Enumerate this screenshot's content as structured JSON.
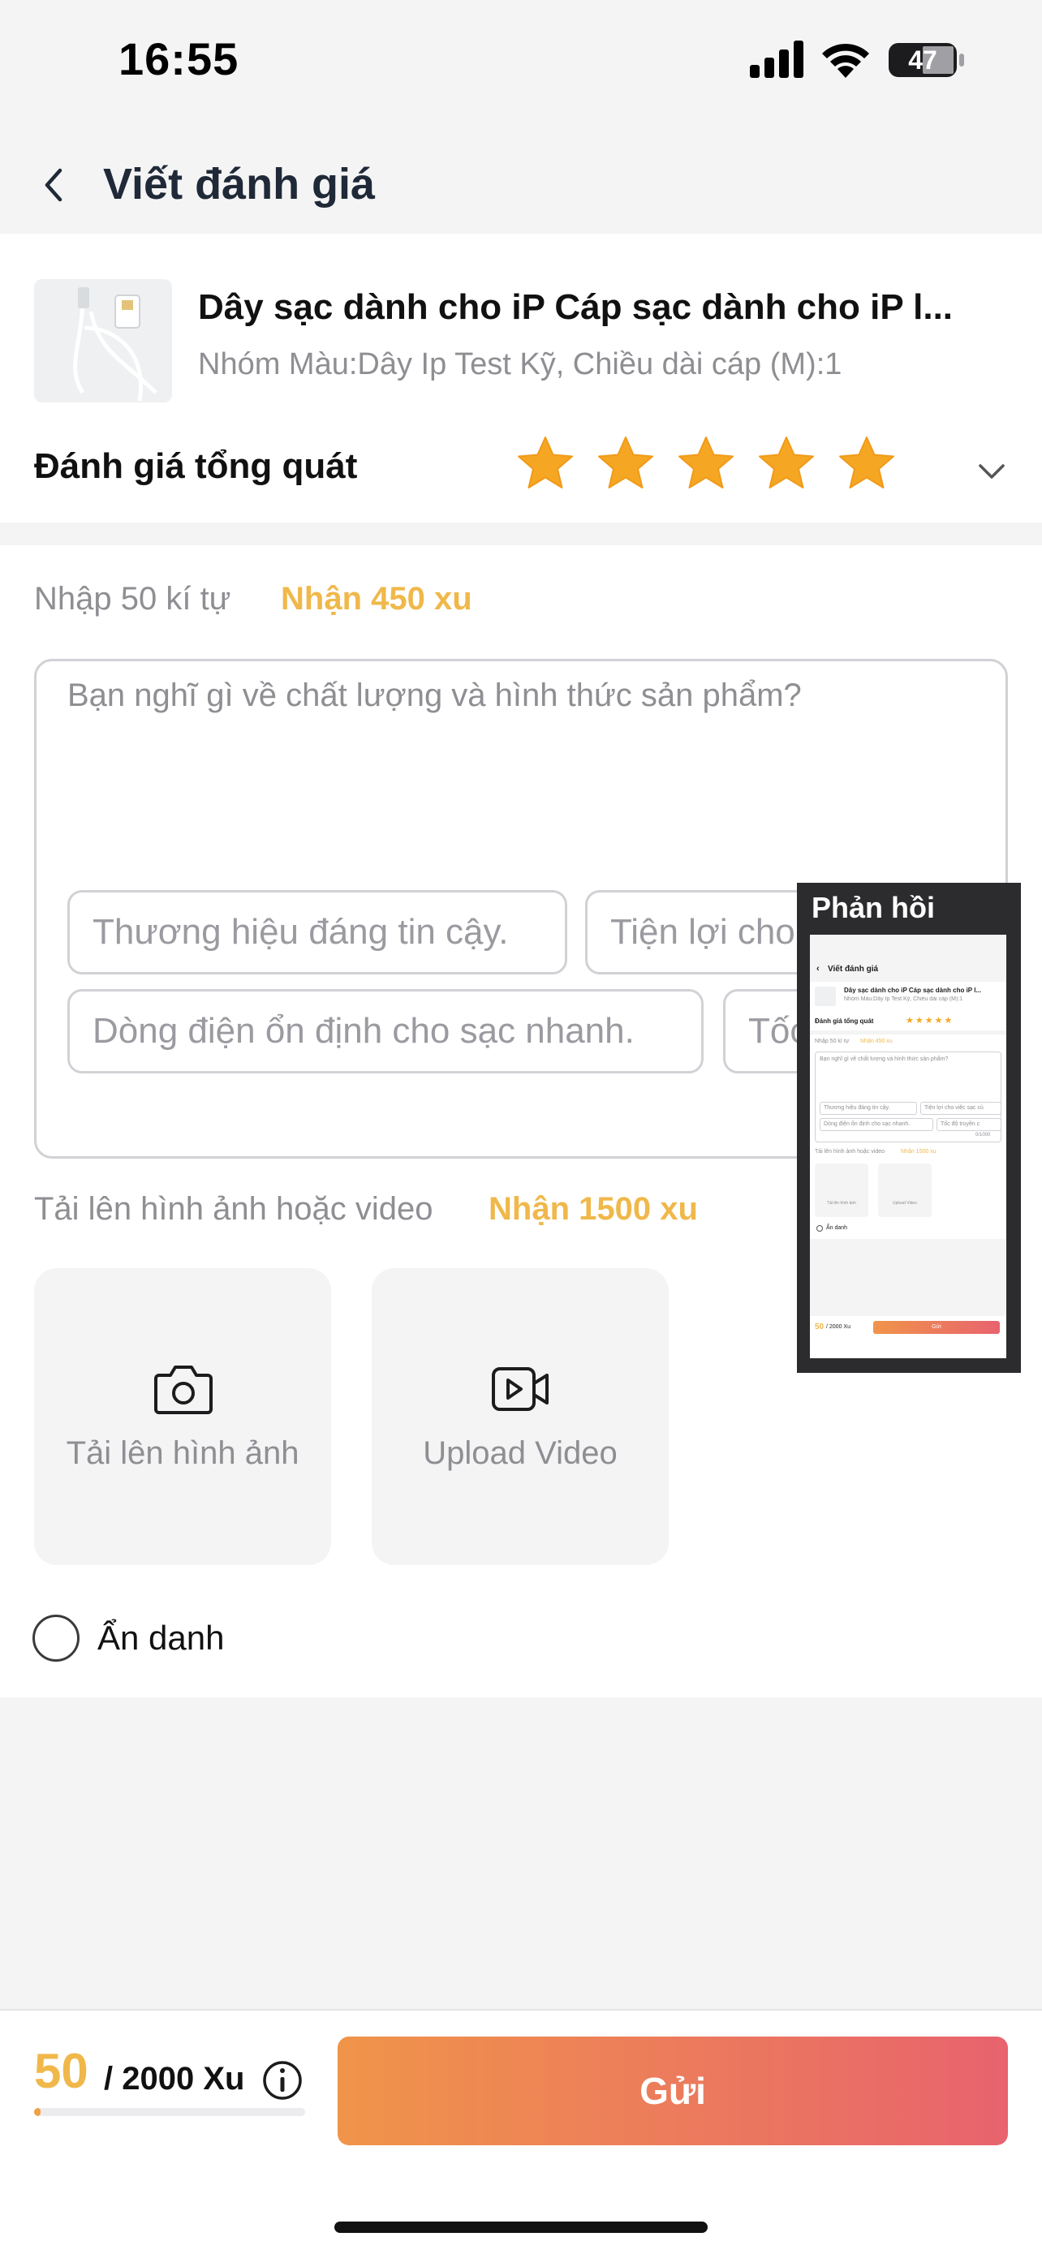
{
  "status_bar": {
    "time": "16:55",
    "battery": "47"
  },
  "header": {
    "title": "Viết đánh giá"
  },
  "product": {
    "name": "Dây sạc dành cho iP Cáp sạc dành cho iP l...",
    "variant": "Nhóm Màu:Dây Ip Test Kỹ, Chiều dài cáp (M):1"
  },
  "rating": {
    "label": "Đánh giá tổng quát",
    "stars": 5,
    "max": 5,
    "star_color": "#f5a623"
  },
  "review": {
    "chars_label": "Nhập 50 kí tự",
    "chars_reward": "Nhận 450 xu",
    "placeholder": "Bạn nghĩ gì về chất lượng và hình thức sản phẩm?",
    "chips": [
      "Thương hiệu đáng tin cậy.",
      "Tiện lợi cho",
      "Dòng điện ổn định cho sạc nhanh.",
      "Tốc"
    ]
  },
  "upload": {
    "label": "Tải lên hình ảnh hoặc video",
    "reward": "Nhận 1500 xu",
    "image_label": "Tải lên hình ảnh",
    "video_label": "Upload Video"
  },
  "anonymous": {
    "label": "Ẩn danh"
  },
  "footer": {
    "xu_current": "50",
    "xu_total": "/ 2000 Xu",
    "progress": 0.025,
    "submit_label": "Gửi",
    "accent": "#f0b84a"
  },
  "feedback_overlay": {
    "title": "Phản hồi",
    "preview": {
      "title": "Viết đánh giá",
      "product": "Dây sạc dành cho iP Cáp sạc dành cho iP l...",
      "variant": "Nhóm Màu:Dây Ip Test Kỹ, Chiều dài cáp (M):1",
      "overall": "Đánh giá tổng quát",
      "chars": "Nhập 50 kí tự",
      "chars_reward": "Nhận 450 xu",
      "placeholder": "Bạn nghĩ gì về chất lượng và hình thức sản phẩm?",
      "chip1": "Thương hiệu đáng tin cậy.",
      "chip2": "Tiện lợi cho việc sạc củ",
      "chip3": "Dòng điện ổn định cho sạc nhanh.",
      "chip4": "Tốc độ truyền c",
      "counter": "0/1000",
      "upload": "Tải lên hình ảnh hoặc video",
      "upload_reward": "Nhận 1500 xu",
      "image": "Tải lên hình ảnh",
      "video": "Upload Video",
      "anon": "Ẩn danh",
      "xu_current": "50",
      "xu_total": "/ 2000 Xu",
      "submit": "Gửi"
    }
  }
}
